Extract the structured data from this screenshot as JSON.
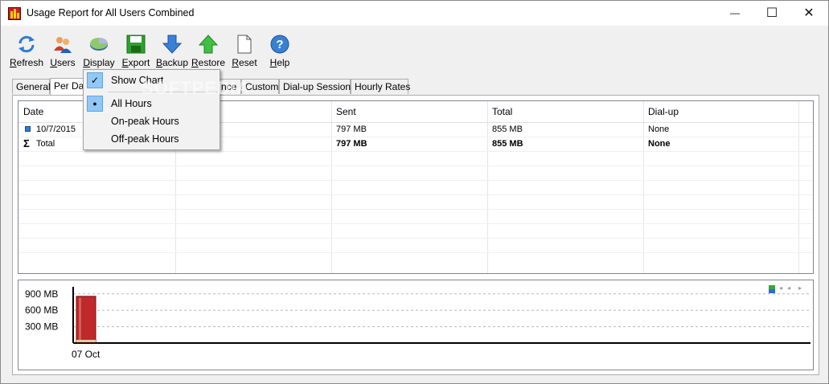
{
  "window": {
    "title": "Usage Report for All Users Combined",
    "min_glyph": "—",
    "max_glyph": "☐",
    "close_glyph": "✕"
  },
  "toolbar": [
    {
      "name": "refresh",
      "label": "Refresh",
      "icon": "refresh-icon"
    },
    {
      "name": "users",
      "label": "Users",
      "icon": "users-icon"
    },
    {
      "name": "display",
      "label": "Display",
      "icon": "display-icon"
    },
    {
      "name": "export",
      "label": "Export",
      "icon": "save-disk-icon"
    },
    {
      "name": "backup",
      "label": "Backup",
      "icon": "arrow-down-icon"
    },
    {
      "name": "restore",
      "label": "Restore",
      "icon": "arrow-up-icon"
    },
    {
      "name": "reset",
      "label": "Reset",
      "icon": "blank-page-icon"
    },
    {
      "name": "help",
      "label": "Help",
      "icon": "help-icon"
    }
  ],
  "tabs": [
    {
      "label": "General"
    },
    {
      "label": "Per Da"
    },
    {
      "label": "nce"
    },
    {
      "label": "Custom"
    },
    {
      "label": "Dial-up Sessions"
    },
    {
      "label": "Hourly Rates"
    }
  ],
  "grid": {
    "columns": [
      "Date",
      "",
      "Sent",
      "Total",
      "Dial-up"
    ],
    "rows": [
      {
        "date": "10/7/2015",
        "received": "",
        "sent": "797 MB",
        "total": "855 MB",
        "dialup": "None"
      }
    ],
    "total_row": {
      "label": "Total",
      "sent": "797 MB",
      "total": "855 MB",
      "dialup": "None"
    }
  },
  "chart_data": {
    "type": "bar",
    "categories": [
      "07 Oct"
    ],
    "values": [
      855
    ],
    "y_ticks": [
      "900 MB",
      "600 MB",
      "300 MB"
    ],
    "ylim": [
      0,
      1000
    ],
    "grid": true,
    "bar_color": "#c0282a",
    "gridline_style": "dashed"
  },
  "menu": {
    "items": [
      {
        "label": "Show Chart",
        "mark": "✓",
        "checked": true
      },
      {
        "label": "All Hours",
        "mark": "●",
        "checked": true
      },
      {
        "label": "On-peak Hours",
        "mark": "",
        "checked": false
      },
      {
        "label": "Off-peak Hours",
        "mark": "",
        "checked": false
      }
    ]
  },
  "watermark": "SOFTPEDIA"
}
